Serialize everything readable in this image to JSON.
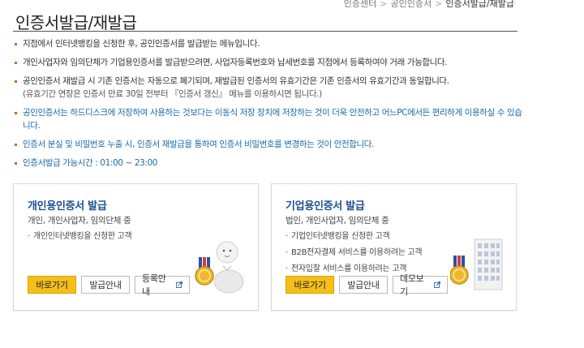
{
  "breadcrumb": {
    "items": [
      "인증센터",
      "공인인증서"
    ],
    "current": "인증서발급/재발급"
  },
  "page": {
    "title": "인증서발급/재발급"
  },
  "notices": [
    {
      "text": "지점에서 인터넷뱅킹을 신청한 후, 공인인증서를 발급받는 메뉴입니다.",
      "style": "normal"
    },
    {
      "text": "개인사업자와 임의단체가 기업용인증서를 발급받으려면, 사업자등록번호와 납세번호를 지점에서 등록하여야 거래 가능합니다.",
      "style": "normal"
    },
    {
      "text": "공인인증서 재발급 시 기존 인증서는 자동으로 폐기되며, 재발급된 인증서의 유효기간은 기존 인증서의 유효기간과 동일합니다.",
      "sub": "(유효기간 연장은 인증서 만료 30일 전부터 『인증서 갱신』 메뉴를 이용하시면 됩니다.)",
      "style": "normal"
    },
    {
      "text": "공인인증서는 하드디스크에 저장하여 사용하는 것보다는 이동식 저장 장치에 저장하는 것이 더욱 안전하고 어느PC에서든 편리하게 이용하실 수 있습니다.",
      "style": "blue"
    },
    {
      "text": "인증서 분실 및 비밀번호 누출 시, 인증서 재발급을 통하여 인증서 비밀번호를 변경하는 것이 안전합니다.",
      "style": "blue"
    },
    {
      "text": "인증서발급 가능시간 : 01:00 ~ 23:00",
      "style": "blue"
    }
  ],
  "cards": {
    "personal": {
      "title": "개인용인증서 발급",
      "subtitle": "개인, 개인사업자, 임의단체 중",
      "bullets": [
        "개인인터넷뱅킹을 신청한 고객"
      ],
      "buttons": {
        "go": "바로가기",
        "guide": "발급안내",
        "register": "등록안내"
      }
    },
    "business": {
      "title": "기업용인증서 발급",
      "subtitle": "법인, 개인사업자, 임의단체 중",
      "bullets": [
        "기업인터넷뱅킹을 신청한 고객",
        "B2B전자결제 서비스를 이용하려는 고객",
        "전자입찰 서비스를 이용하려는 고객"
      ],
      "buttons": {
        "go": "바로가기",
        "guide": "발급안내",
        "demo": "데모보기"
      }
    }
  },
  "colors": {
    "accent_button": "#f4bf1a",
    "notice_blue": "#1a6aa7",
    "bullet_orange": "#e06000",
    "card_title": "#1d4f91"
  },
  "icons": {
    "personal_illustration": "person-medal-icon",
    "business_illustration": "building-medal-icon",
    "external": "external-link-icon"
  }
}
